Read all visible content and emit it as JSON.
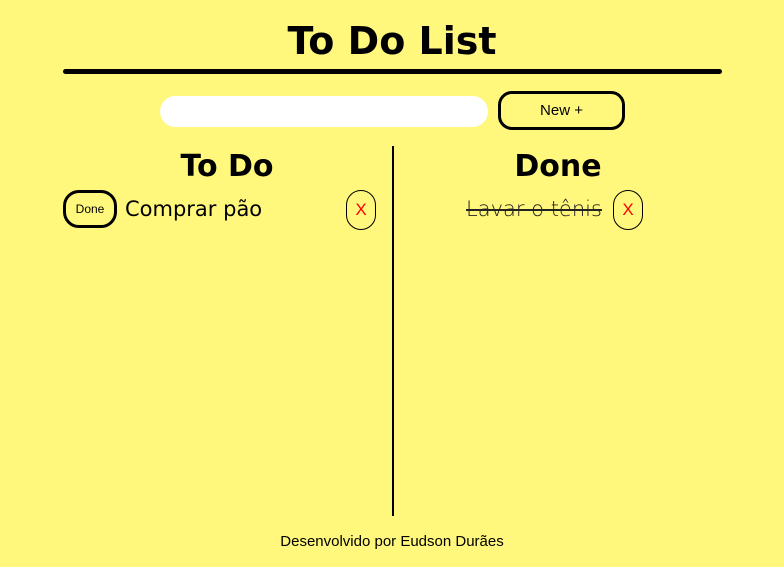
{
  "header": {
    "title": "To Do List"
  },
  "new_task": {
    "input_value": "",
    "input_placeholder": "",
    "button_label": "New +"
  },
  "todo_column": {
    "heading": "To Do",
    "items": [
      {
        "done_button_label": "Done",
        "text": "Comprar pão",
        "remove_label": "X"
      }
    ]
  },
  "done_column": {
    "heading": "Done",
    "items": [
      {
        "text": "Lavar o tênis",
        "remove_label": "X"
      }
    ]
  },
  "footer": {
    "credit": "Desenvolvido por Eudson Durães"
  },
  "colors": {
    "background": "#fff87c",
    "remove_accent": "#ff0000"
  }
}
